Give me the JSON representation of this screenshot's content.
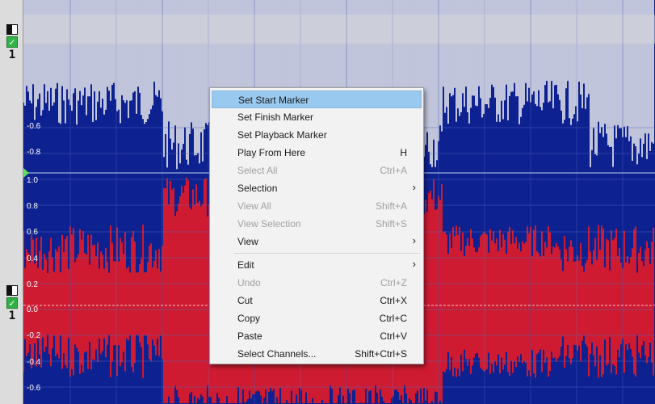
{
  "channels": [
    {
      "number": "1"
    },
    {
      "number": "1"
    }
  ],
  "axis_labels": {
    "top": [
      "-0.6",
      "-0.8"
    ],
    "bottom": [
      "1.0",
      "0.8",
      "0.6",
      "0.4",
      "0.2",
      "0.0",
      "-0.2",
      "-0.4",
      "-0.6"
    ]
  },
  "colors": {
    "background": "#0e2190",
    "top_wave": "#eeeeee",
    "bottom_wave": "#ff1a1a",
    "grid": "#5566bb",
    "menu_highlight": "#99c9ef"
  },
  "context_menu": {
    "items": [
      {
        "label": "Set Start Marker",
        "shortcut": "",
        "submenu": false,
        "disabled": false,
        "highlighted": true
      },
      {
        "label": "Set Finish Marker",
        "shortcut": "",
        "submenu": false,
        "disabled": false,
        "highlighted": false
      },
      {
        "label": "Set Playback Marker",
        "shortcut": "",
        "submenu": false,
        "disabled": false,
        "highlighted": false
      },
      {
        "label": "Play From Here",
        "shortcut": "H",
        "submenu": false,
        "disabled": false,
        "highlighted": false
      },
      {
        "label": "Select All",
        "shortcut": "Ctrl+A",
        "submenu": false,
        "disabled": true,
        "highlighted": false
      },
      {
        "label": "Selection",
        "shortcut": "",
        "submenu": true,
        "disabled": false,
        "highlighted": false
      },
      {
        "label": "View All",
        "shortcut": "Shift+A",
        "submenu": false,
        "disabled": true,
        "highlighted": false
      },
      {
        "label": "View Selection",
        "shortcut": "Shift+S",
        "submenu": false,
        "disabled": true,
        "highlighted": false
      },
      {
        "label": "View",
        "shortcut": "",
        "submenu": true,
        "disabled": false,
        "highlighted": false
      },
      {
        "label": "Edit",
        "shortcut": "",
        "submenu": true,
        "disabled": false,
        "highlighted": false
      },
      {
        "label": "Undo",
        "shortcut": "Ctrl+Z",
        "submenu": false,
        "disabled": true,
        "highlighted": false
      },
      {
        "label": "Cut",
        "shortcut": "Ctrl+X",
        "submenu": false,
        "disabled": false,
        "highlighted": false
      },
      {
        "label": "Copy",
        "shortcut": "Ctrl+C",
        "submenu": false,
        "disabled": false,
        "highlighted": false
      },
      {
        "label": "Paste",
        "shortcut": "Ctrl+V",
        "submenu": false,
        "disabled": false,
        "highlighted": false
      },
      {
        "label": "Select Channels...",
        "shortcut": "Shift+Ctrl+S",
        "submenu": false,
        "disabled": false,
        "highlighted": false
      }
    ]
  }
}
